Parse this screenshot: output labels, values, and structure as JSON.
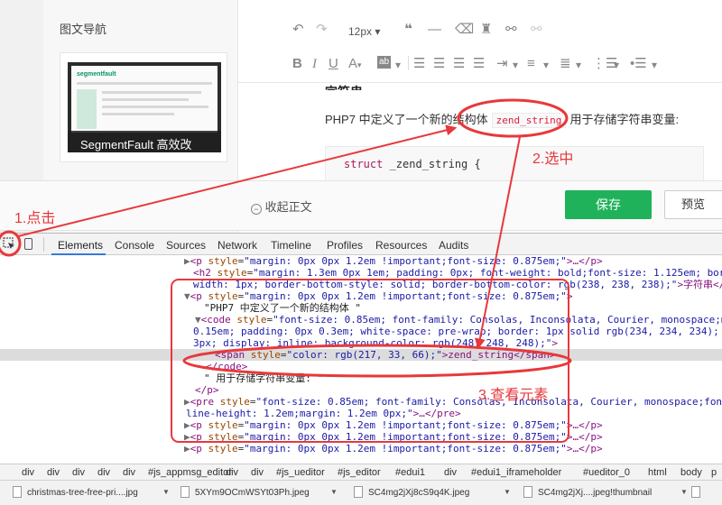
{
  "editor": {
    "nav_title": "图文导航",
    "thumb_caption": "SegmentFault 高效改",
    "thumb_logo": "segmentfault",
    "font_size": "12px",
    "para_before": "PHP7 中定义了一个新的结构体",
    "para_code": "zend_string",
    "para_after": "用于存储字符串变量:",
    "code_keyword": "struct",
    "code_rest": " _zend_string {",
    "heading_partial": "字符串",
    "collapse_label": "收起正文",
    "save_label": "保存",
    "preview_label": "预览"
  },
  "toolbar_icons": [
    "undo-icon",
    "redo-icon",
    "quote-icon",
    "horizontal-rule-icon",
    "eraser-icon",
    "format-brush-icon",
    "link-icon",
    "unlink-icon",
    "bold-icon",
    "italic-icon",
    "underline-icon",
    "font-color-icon",
    "background-color-icon",
    "align-left-icon",
    "align-center-icon",
    "align-right-icon",
    "justify-icon",
    "indent-icon",
    "line-height-icon",
    "list-ordered-icon",
    "list-unordered-icon"
  ],
  "devtools": {
    "tabs": [
      "Elements",
      "Console",
      "Sources",
      "Network",
      "Timeline",
      "Profiles",
      "Resources",
      "Audits"
    ],
    "active_tab": "Elements",
    "dom": {
      "l0": {
        "tri": "▶",
        "open": "<p ",
        "attr": "style",
        "val": "\"margin: 0px 0px 1.2em !important;font-size: 0.875em;\"",
        "rest": ">…</p>"
      },
      "l1a": {
        "open": "<h2 ",
        "attr": "style",
        "val": "\"margin: 1.3em 0px 1em; padding: 0px; font-weight: bold;font-size: 1.125em; border-bottom-"
      },
      "l1b": {
        "val": "width: 1px; border-bottom-style: solid; border-bottom-color: rgb(238, 238, 238);\"",
        "rest": ">字符串</h2>"
      },
      "l2": {
        "tri": "▼",
        "open": "<p ",
        "attr": "style",
        "val": "\"margin: 0px 0px 1.2em !important;font-size: 0.875em;\"",
        "rest": ">"
      },
      "l3": {
        "text": "\"PHP7 中定义了一个新的结构体 \""
      },
      "l4a": {
        "tri": "▼",
        "open": "<code ",
        "attr": "style",
        "val": "\"font-size: 0.85em; font-family: Consolas, Inconsolata, Courier, monospace;margin: 0px"
      },
      "l4b": {
        "val": "0.15em; padding: 0px 0.3em; white-space: pre-wrap; border: 1px solid rgb(234, 234, 234); border-radius:"
      },
      "l4c": {
        "val": "3px; display: inline; background-color: rgb(248, 248, 248);\"",
        "rest": ">"
      },
      "l5": {
        "open": "<span ",
        "attr": "style",
        "val": "\"color: rgb(217, 33, 66);\"",
        "text": ">zend_string</span>"
      },
      "l6": {
        "text": "</code>"
      },
      "l7": {
        "text": "\" 用于存储字符串变量: \""
      },
      "l8": {
        "text": "</p>"
      },
      "l9a": {
        "tri": "▶",
        "open": "<pre ",
        "attr": "style",
        "val": "\"font-size: 0.85em; font-family: Consolas, Inconsolata, Courier, monospace;font-size: 1em;"
      },
      "l9b": {
        "val": "line-height: 1.2em;margin: 1.2em 0px;\"",
        "rest": ">…</pre>"
      },
      "l10": {
        "tri": "▶",
        "open": "<p ",
        "attr": "style",
        "val": "\"margin: 0px 0px 1.2em !important;font-size: 0.875em;\"",
        "rest": ">…</p>"
      },
      "l11": {
        "tri": "▶",
        "open": "<p ",
        "attr": "style",
        "val": "\"margin: 0px 0px 1.2em !important;font-size: 0.875em;\"",
        "rest": ">…</p>"
      },
      "l12": {
        "tri": "▶",
        "open": "<p ",
        "attr": "style",
        "val": "\"margin: 0px 0px 1.2em !important;font-size: 0.875em;\"",
        "rest": ">…</p>"
      }
    },
    "breadcrumbs": [
      "div",
      "div",
      "div",
      "div",
      "div",
      "#js_appmsg_editor",
      "div",
      "div",
      "#js_ueditor",
      "#js_editor",
      "#edui1",
      "div",
      "#edui1_iframeholder",
      "#ueditor_0",
      "html",
      "body",
      "p"
    ]
  },
  "downloads": [
    "christmas-tree-free-pri....jpg",
    "5XYm9OCmWSYt03Ph.jpeg",
    "SC4mg2jXj8cS9q4K.jpeg",
    "SC4mg2jXj....jpeg!thumbnail"
  ],
  "annotations": {
    "a1": "1.点击",
    "a2": "2.选中",
    "a3": "3.查看元素"
  },
  "colors": {
    "accent_green": "#1fb25a",
    "annotation_red": "#e8383b",
    "devtools_blue": "#3879d9"
  }
}
